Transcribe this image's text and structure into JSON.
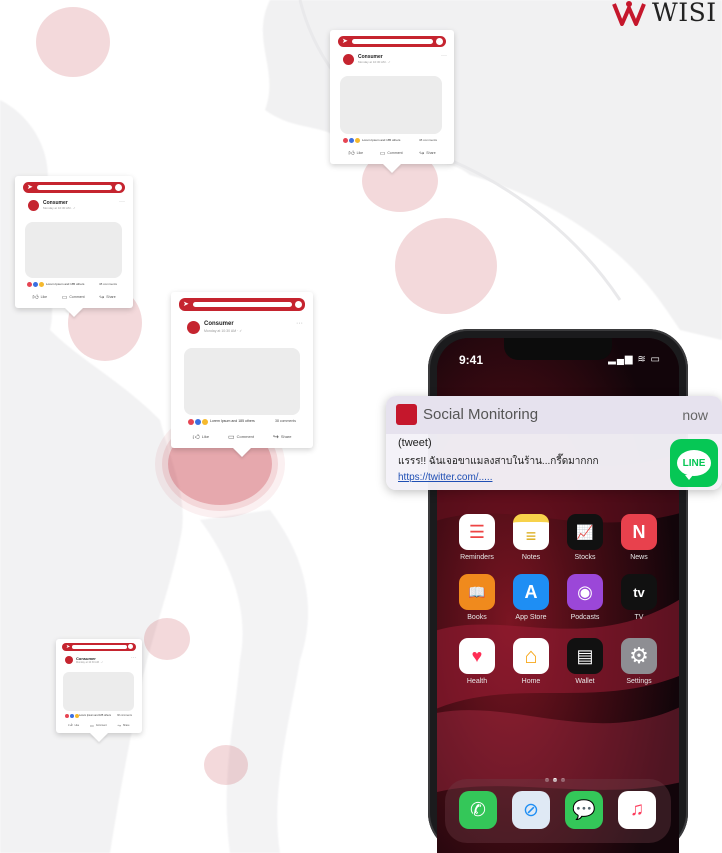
{
  "brand": {
    "name": "WISE",
    "visible_text": "WISI",
    "mark_color": "#c5172c"
  },
  "posts": [
    {
      "id": "post-north",
      "user": "Consumer",
      "time": "Monday at 10:30 AM · ✓",
      "reactions": "Lorem Ipsum and 185 others",
      "comments": "38 comments",
      "like": "Like",
      "comment": "Comment",
      "share": "Share"
    },
    {
      "id": "post-west",
      "user": "Consumer",
      "time": "Monday at 10:30 AM · ✓",
      "reactions": "Lorem Ipsum and 185 others",
      "comments": "38 comments",
      "like": "Like",
      "comment": "Comment",
      "share": "Share"
    },
    {
      "id": "post-center",
      "user": "Consumer",
      "time": "Monday at 10:30 AM · ✓",
      "reactions": "Lorem Ipsum and 185 others",
      "comments": "38 comments",
      "like": "Like",
      "comment": "Comment",
      "share": "Share"
    },
    {
      "id": "post-south",
      "user": "Consumer",
      "time": "Monday at 10:30 AM · ✓",
      "reactions": "Lorem Ipsum and 185 others",
      "comments": "38 comments",
      "like": "Like",
      "comment": "Comment",
      "share": "Share"
    }
  ],
  "phone": {
    "time": "9:41",
    "status_icons": "▂▄▆ ≋ ▭",
    "apps": [
      {
        "label": "Reminders",
        "icon": "reminders-icon",
        "color": "#ffffff",
        "glyph": "☰"
      },
      {
        "label": "Notes",
        "icon": "notes-icon",
        "color": "#f7d24b",
        "glyph": "≡"
      },
      {
        "label": "Stocks",
        "icon": "stocks-icon",
        "color": "#111111",
        "glyph": "📈"
      },
      {
        "label": "News",
        "icon": "news-icon",
        "color": "#e8414d",
        "glyph": "N"
      },
      {
        "label": "Books",
        "icon": "books-icon",
        "color": "#f08a1d",
        "glyph": "📖"
      },
      {
        "label": "App Store",
        "icon": "app-store-icon",
        "color": "#1e8ef4",
        "glyph": "A"
      },
      {
        "label": "Podcasts",
        "icon": "podcasts-icon",
        "color": "#9b47d8",
        "glyph": "◉"
      },
      {
        "label": "TV",
        "icon": "tv-icon",
        "color": "#111111",
        "glyph": "tv"
      },
      {
        "label": "Health",
        "icon": "health-icon",
        "color": "#ffffff",
        "glyph": "♥"
      },
      {
        "label": "Home",
        "icon": "home-icon",
        "color": "#f7a81b",
        "glyph": "⌂"
      },
      {
        "label": "Wallet",
        "icon": "wallet-icon",
        "color": "#111111",
        "glyph": "▤"
      },
      {
        "label": "Settings",
        "icon": "settings-icon",
        "color": "#8e8e93",
        "glyph": "⚙"
      }
    ],
    "dock": [
      {
        "icon": "phone-icon",
        "color": "#34c759",
        "glyph": "✆"
      },
      {
        "icon": "safari-icon",
        "color": "#dfe9f5",
        "glyph": "⊘"
      },
      {
        "icon": "messages-icon",
        "color": "#34c759",
        "glyph": "💬"
      },
      {
        "icon": "music-icon",
        "color": "#fc3c5c",
        "glyph": "♫"
      }
    ]
  },
  "notification": {
    "app_name": "Social Monitoring",
    "time": "now",
    "tag": "(tweet)",
    "message": "แรรร!! ฉันเจอขาแมลงสาบในร้าน...กรี๊ดมากกก",
    "link": "https://twitter.com/.....",
    "badge_text": "LINE",
    "badge_color": "#06c755"
  },
  "colors": {
    "accent": "#c5242f",
    "hotspot": "#c9505c"
  }
}
